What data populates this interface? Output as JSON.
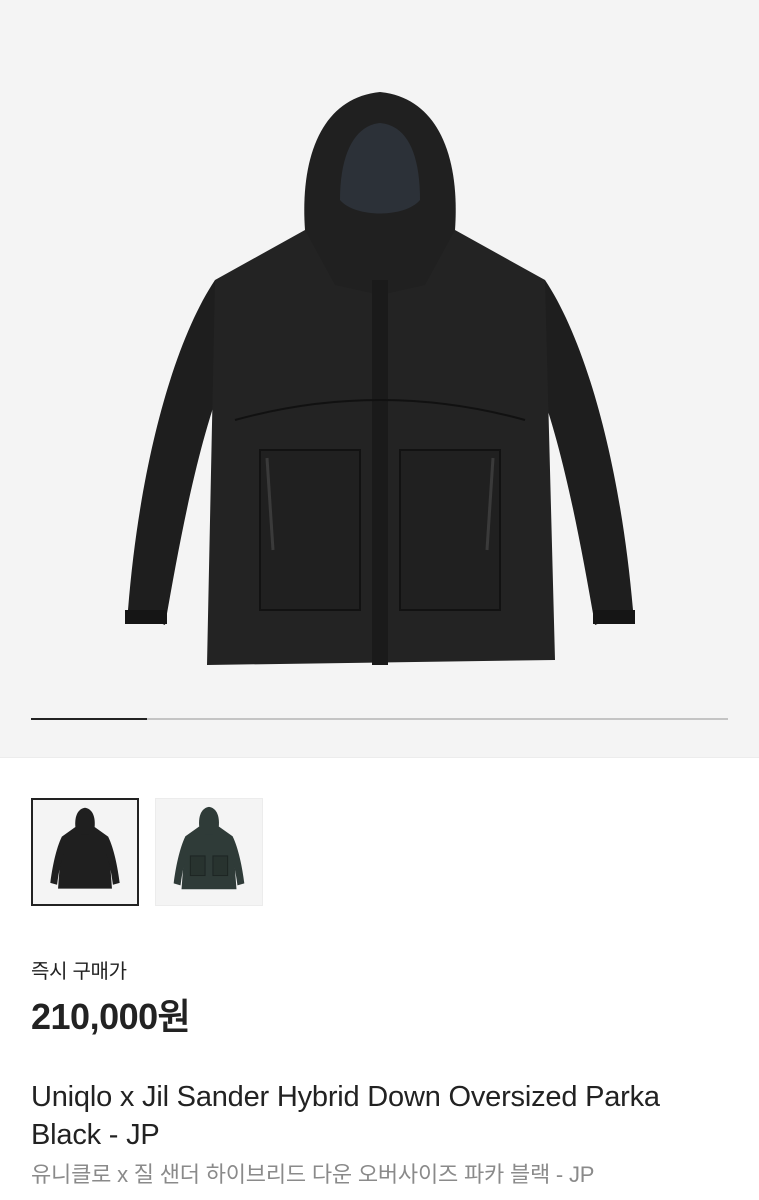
{
  "gallery": {
    "progress_fraction": 0.166,
    "thumbnails": [
      {
        "color": "black",
        "selected": true
      },
      {
        "color": "dark-green",
        "selected": false
      }
    ]
  },
  "product": {
    "price_label": "즉시 구매가",
    "price": "210,000원",
    "title_en": "Uniqlo x Jil Sander Hybrid Down Oversized Parka Black - JP",
    "title_ko": "유니클로 x 질 샌더 하이브리드 다운 오버사이즈 파카 블랙 - JP"
  },
  "colors": {
    "accent": "#222222",
    "muted": "#8a8a8a",
    "background": "#f4f4f4"
  }
}
